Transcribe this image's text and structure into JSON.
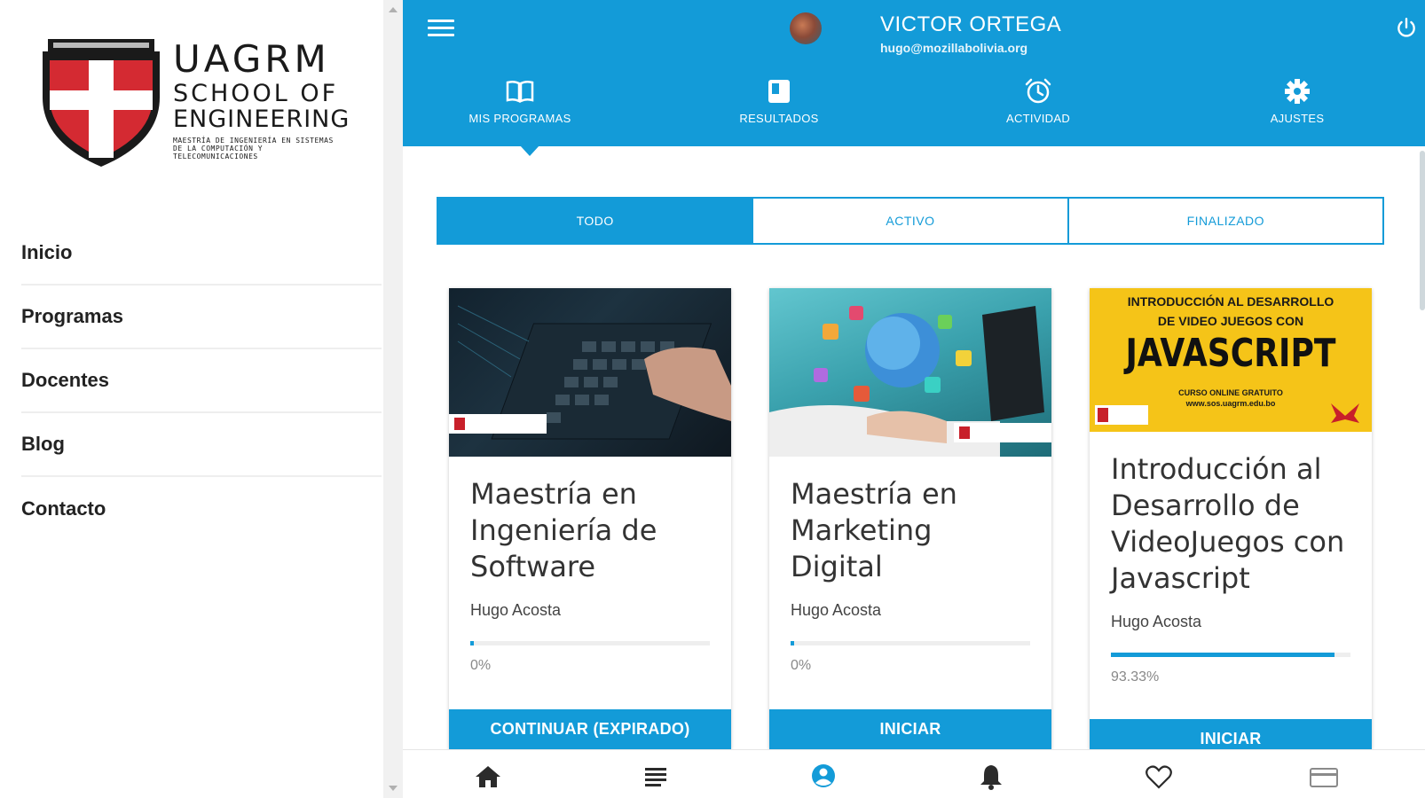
{
  "sidebar": {
    "logo": {
      "title": "UAGRM",
      "line1": "SCHOOL OF",
      "line2": "ENGINEERING",
      "subtitle": "MAESTRÍA DE INGENIERÍA EN SISTEMAS DE LA COMPUTACIÓN Y TELECOMUNICACIONES"
    },
    "items": [
      {
        "label": "Inicio"
      },
      {
        "label": "Programas"
      },
      {
        "label": "Docentes"
      },
      {
        "label": "Blog"
      },
      {
        "label": "Contacto"
      }
    ]
  },
  "header": {
    "user_name": "VICTOR ORTEGA",
    "user_email": "hugo@mozillabolivia.org",
    "nav": [
      {
        "label": "MIS PROGRAMAS",
        "icon": "book-icon"
      },
      {
        "label": "RESULTADOS",
        "icon": "results-icon"
      },
      {
        "label": "ACTIVIDAD",
        "icon": "alarm-icon"
      },
      {
        "label": "AJUSTES",
        "icon": "gear-icon"
      }
    ]
  },
  "filter": {
    "all": "TODO",
    "active": "ACTIVO",
    "finished": "FINALIZADO"
  },
  "courses": [
    {
      "title": "Maestría en Ingeniería de Software",
      "author": "Hugo Acosta",
      "progress": 0,
      "progress_text": "0%",
      "button": "CONTINUAR (EXPIRADO)"
    },
    {
      "title": "Maestría en Marketing Digital",
      "author": "Hugo Acosta",
      "progress": 0,
      "progress_text": "0%",
      "button": "INICIAR"
    },
    {
      "title": "Introducción al Desarrollo de VideoJuegos con Javascript",
      "author": "Hugo Acosta",
      "progress": 93.33,
      "progress_text": "93.33%",
      "button": "INICIAR",
      "banner_line1": "INTRODUCCIÓN AL DESARROLLO",
      "banner_line2": "DE VIDEO JUEGOS CON",
      "banner_big": "JAVASCRIPT",
      "banner_small1": "CURSO ONLINE GRATUITO",
      "banner_small2": "www.sos.uagrm.edu.bo"
    }
  ],
  "bottom_nav": [
    "home-icon",
    "list-icon",
    "profile-icon",
    "bell-icon",
    "heart-icon",
    "card-icon"
  ],
  "colors": {
    "accent": "#139bd8",
    "logo_red": "#c8202a"
  }
}
